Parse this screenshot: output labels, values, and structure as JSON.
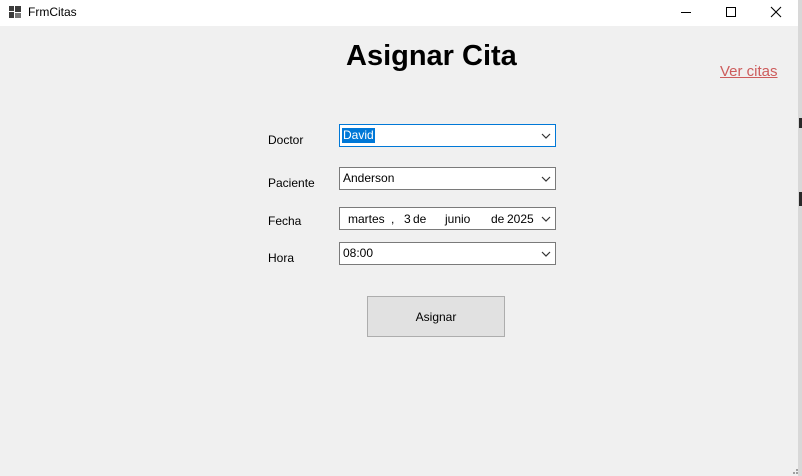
{
  "window": {
    "title": "FrmCitas",
    "controls": {
      "minimize_icon": "minimize-icon",
      "maximize_icon": "maximize-icon",
      "close_icon": "close-icon"
    }
  },
  "header": {
    "title": "Asignar Cita"
  },
  "links": {
    "ver_citas": "Ver citas"
  },
  "form": {
    "doctor": {
      "label": "Doctor",
      "value": "David"
    },
    "paciente": {
      "label": "Paciente",
      "value": "Anderson"
    },
    "fecha": {
      "label": "Fecha",
      "weekday": "martes",
      "sep": ",",
      "day": "3",
      "de1": "de",
      "month": "junio",
      "de2": "de",
      "year": "2025"
    },
    "hora": {
      "label": "Hora",
      "value": "08:00"
    }
  },
  "actions": {
    "asignar_label": "Asignar"
  },
  "colors": {
    "background": "#f0f0f0",
    "link": "#cd5c5c",
    "selection": "#0078d7",
    "button_face": "#e1e1e1"
  }
}
